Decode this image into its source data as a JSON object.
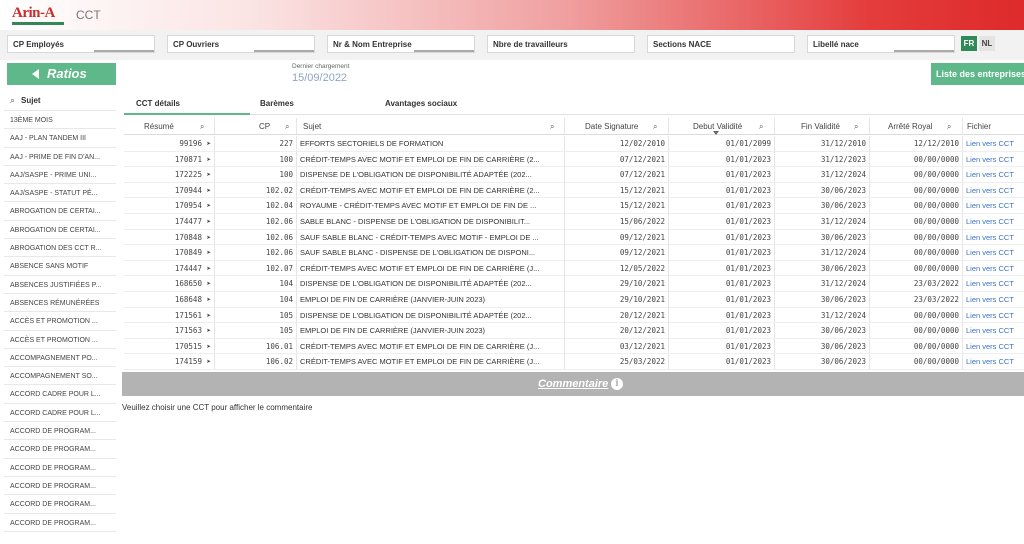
{
  "app": {
    "logo": "Arin-A",
    "title": "CCT"
  },
  "filters": [
    "CP Employés",
    "CP Ouvriers",
    "Nr & Nom Entreprise",
    "Nbre de travailleurs",
    "Sections NACE",
    "Libellé nace"
  ],
  "lang": {
    "fr": "FR",
    "nl": "NL"
  },
  "ratios_label": "Ratios",
  "last_load": {
    "label": "Dernier chargement",
    "date": "15/09/2022"
  },
  "list_button": "Liste des entreprises",
  "sidebar": {
    "header": "Sujet",
    "items": [
      "13ÈME MOIS",
      "AAJ - PLAN TANDEM III",
      "AAJ - PRIME DE FIN D'AN...",
      "AAJ/SASPE - PRIME UNI...",
      "AAJ/SASPE - STATUT PÉ...",
      "ABROGATION DE CERTAI...",
      "ABROGATION DE CERTAI...",
      "ABROGATION DES CCT R...",
      "ABSENCE SANS MOTIF",
      "ABSENCES JUSTIFIÉES P...",
      "ABSENCES RÉMUNÉRÉES",
      "ACCÈS ET PROMOTION ...",
      "ACCÈS ET PROMOTION ...",
      "ACCOMPAGNEMENT PO...",
      "ACCOMPAGNEMENT SO...",
      "ACCORD CADRE POUR L...",
      "ACCORD CADRE POUR L...",
      "ACCORD DE PROGRAM...",
      "ACCORD DE PROGRAM...",
      "ACCORD DE PROGRAM...",
      "ACCORD DE PROGRAM...",
      "ACCORD DE PROGRAM...",
      "ACCORD DE PROGRAM..."
    ]
  },
  "tabs": [
    "CCT détails",
    "Barèmes",
    "Avantages sociaux"
  ],
  "table": {
    "headers": [
      "Résumé",
      "CP",
      "Sujet",
      "Date Signature",
      "Debut Validité",
      "Fin Validité",
      "Arrêté Royal",
      "Fichier"
    ],
    "rows": [
      [
        "99196 ➤",
        "227",
        "EFFORTS SECTORIELS DE FORMATION",
        "12/02/2010",
        "01/01/2099",
        "31/12/2010",
        "12/12/2010",
        "Lien vers CCT"
      ],
      [
        "170871 ➤",
        "100",
        "CRÉDIT-TEMPS AVEC MOTIF ET EMPLOI DE FIN DE CARRIÈRE (2...",
        "07/12/2021",
        "01/01/2023",
        "31/12/2023",
        "00/00/0000",
        "Lien vers CCT"
      ],
      [
        "172225 ➤",
        "100",
        "DISPENSE DE L'OBLIGATION DE DISPONIBILITÉ ADAPTÉE (202...",
        "07/12/2021",
        "01/01/2023",
        "31/12/2024",
        "00/00/0000",
        "Lien vers CCT"
      ],
      [
        "170944 ➤",
        "102.02",
        "CRÉDIT-TEMPS AVEC MOTIF ET EMPLOI DE FIN DE CARRIÈRE (2...",
        "15/12/2021",
        "01/01/2023",
        "30/06/2023",
        "00/00/0000",
        "Lien vers CCT"
      ],
      [
        "170954 ➤",
        "102.04",
        "ROYAUME - CRÉDIT-TEMPS AVEC MOTIF ET EMPLOI DE FIN DE ...",
        "15/12/2021",
        "01/01/2023",
        "30/06/2023",
        "00/00/0000",
        "Lien vers CCT"
      ],
      [
        "174477 ➤",
        "102.06",
        "SABLE BLANC - DISPENSE DE L'OBLIGATION DE DISPONIBILIT...",
        "15/06/2022",
        "01/01/2023",
        "31/12/2024",
        "00/00/0000",
        "Lien vers CCT"
      ],
      [
        "170848 ➤",
        "102.06",
        "SAUF SABLE BLANC - CRÉDIT-TEMPS AVEC MOTIF - EMPLOI DE ...",
        "09/12/2021",
        "01/01/2023",
        "30/06/2023",
        "00/00/0000",
        "Lien vers CCT"
      ],
      [
        "170849 ➤",
        "102.06",
        "SAUF SABLE BLANC - DISPENSE DE L'OBLIGATION DE DISPONI...",
        "09/12/2021",
        "01/01/2023",
        "31/12/2024",
        "00/00/0000",
        "Lien vers CCT"
      ],
      [
        "174447 ➤",
        "102.07",
        "CRÉDIT-TEMPS AVEC MOTIF ET EMPLOI DE FIN DE CARRIÈRE (J...",
        "12/05/2022",
        "01/01/2023",
        "30/06/2023",
        "00/00/0000",
        "Lien vers CCT"
      ],
      [
        "168650 ➤",
        "104",
        "DISPENSE DE L'OBLIGATION DE DISPONIBILITÉ ADAPTÉE (202...",
        "29/10/2021",
        "01/01/2023",
        "31/12/2024",
        "23/03/2022",
        "Lien vers CCT"
      ],
      [
        "168648 ➤",
        "104",
        "EMPLOI DE FIN DE CARRIÈRE (JANVIER-JUIN 2023)",
        "29/10/2021",
        "01/01/2023",
        "30/06/2023",
        "23/03/2022",
        "Lien vers CCT"
      ],
      [
        "171561 ➤",
        "105",
        "DISPENSE DE L'OBLIGATION DE DISPONIBILITÉ ADAPTÉE (202...",
        "20/12/2021",
        "01/01/2023",
        "31/12/2024",
        "00/00/0000",
        "Lien vers CCT"
      ],
      [
        "171563 ➤",
        "105",
        "EMPLOI DE FIN DE CARRIÈRE (JANVIER-JUIN 2023)",
        "20/12/2021",
        "01/01/2023",
        "30/06/2023",
        "00/00/0000",
        "Lien vers CCT"
      ],
      [
        "170515 ➤",
        "106.01",
        "CRÉDIT-TEMPS AVEC MOTIF ET EMPLOI DE FIN DE CARRIÈRE (J...",
        "03/12/2021",
        "01/01/2023",
        "30/06/2023",
        "00/00/0000",
        "Lien vers CCT"
      ],
      [
        "174159 ➤",
        "106.02",
        "CRÉDIT-TEMPS AVEC MOTIF ET EMPLOI DE FIN DE CARRIÈRE (J...",
        "25/03/2022",
        "01/01/2023",
        "30/06/2023",
        "00/00/0000",
        "Lien vers CCT"
      ]
    ]
  },
  "comment": {
    "label": "Commentaire",
    "info_icon": "info-icon",
    "placeholder": "Veuillez choisir une CCT pour afficher le commentaire"
  }
}
